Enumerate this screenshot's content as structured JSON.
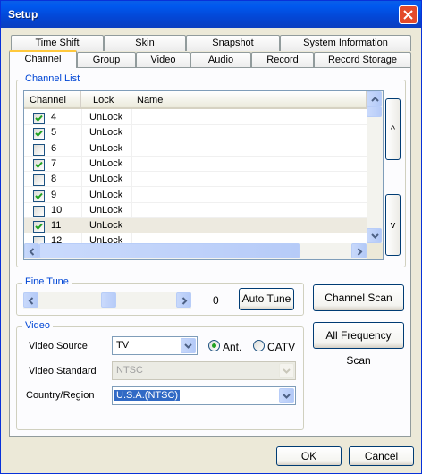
{
  "window": {
    "title": "Setup"
  },
  "tabs_row1": [
    {
      "label": "Time Shift"
    },
    {
      "label": "Skin"
    },
    {
      "label": "Snapshot"
    },
    {
      "label": "System Information"
    }
  ],
  "tabs_row2": [
    {
      "label": "Channel",
      "active": true
    },
    {
      "label": "Group"
    },
    {
      "label": "Video"
    },
    {
      "label": "Audio"
    },
    {
      "label": "Record"
    },
    {
      "label": "Record Storage"
    }
  ],
  "channel_list": {
    "group_label": "Channel List",
    "columns": [
      "Channel",
      "Lock",
      "Name"
    ],
    "rows": [
      {
        "channel": "4",
        "lock": "UnLock",
        "name": "",
        "checked": true
      },
      {
        "channel": "5",
        "lock": "UnLock",
        "name": "",
        "checked": true
      },
      {
        "channel": "6",
        "lock": "UnLock",
        "name": "",
        "checked": false
      },
      {
        "channel": "7",
        "lock": "UnLock",
        "name": "",
        "checked": true
      },
      {
        "channel": "8",
        "lock": "UnLock",
        "name": "",
        "checked": false
      },
      {
        "channel": "9",
        "lock": "UnLock",
        "name": "",
        "checked": true
      },
      {
        "channel": "10",
        "lock": "UnLock",
        "name": "",
        "checked": false
      },
      {
        "channel": "11",
        "lock": "UnLock",
        "name": "",
        "checked": true,
        "selected": true
      },
      {
        "channel": "12",
        "lock": "UnLock",
        "name": "",
        "checked": false
      }
    ],
    "up_label": "^",
    "down_label": "v"
  },
  "fine_tune": {
    "group_label": "Fine Tune",
    "value": "0",
    "auto_tune_label": "Auto Tune"
  },
  "video": {
    "group_label": "Video",
    "source_label": "Video Source",
    "source_value": "TV",
    "ant_label": "Ant.",
    "catv_label": "CATV",
    "input_type": "Ant.",
    "standard_label": "Video Standard",
    "standard_value": "NTSC",
    "region_label": "Country/Region",
    "region_value": "U.S.A.(NTSC)"
  },
  "side_buttons": {
    "channel_scan": "Channel Scan",
    "all_frequency_scan": "All Frequency Scan"
  },
  "footer": {
    "ok": "OK",
    "cancel": "Cancel"
  },
  "colors": {
    "titlebar": "#0058ee",
    "close_button": "#e34a2a",
    "selection": "#316ac5",
    "group_label": "#0046d5"
  }
}
